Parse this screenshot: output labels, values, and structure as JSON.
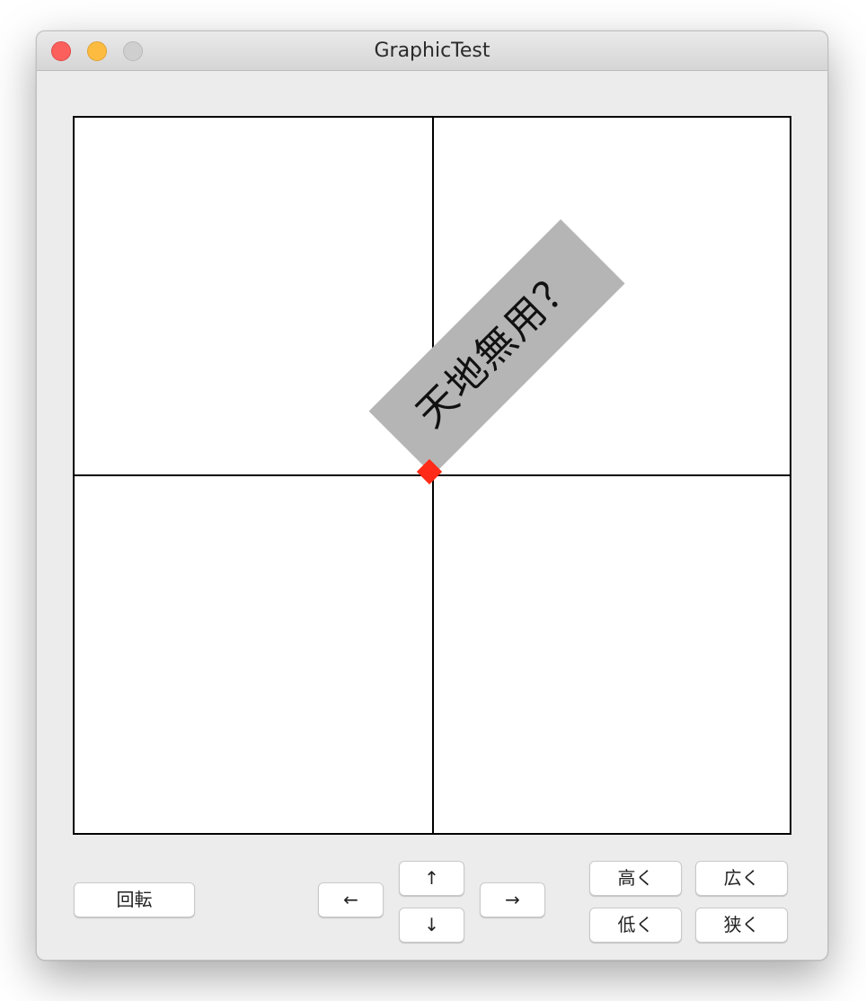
{
  "window": {
    "title": "GraphicTest"
  },
  "canvas": {
    "label_text": "天地無用？"
  },
  "controls": {
    "rotate": "回転",
    "left": "←",
    "up": "↑",
    "down": "↓",
    "right": "→",
    "taller": "高く",
    "lower": "低く",
    "wider": "広く",
    "narrower": "狭く"
  },
  "colors": {
    "label_background": "#b5b5b5",
    "anchor_marker": "#ff2a17",
    "close_button": "#fc605c",
    "minimize_button": "#fdbc40"
  },
  "icons": {
    "close": "traffic-light-close-icon",
    "minimize": "traffic-light-minimize-icon",
    "zoom": "traffic-light-zoom-icon"
  }
}
